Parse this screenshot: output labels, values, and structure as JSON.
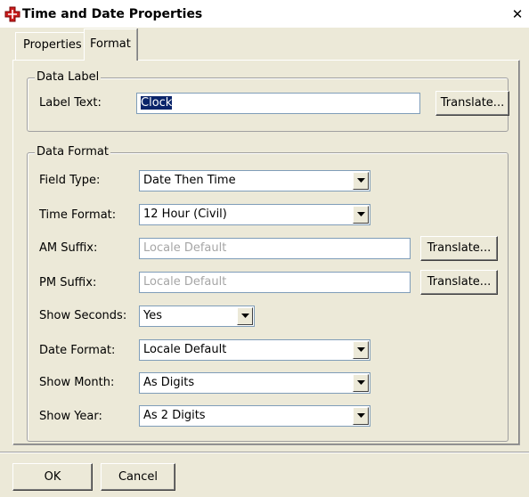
{
  "window": {
    "title": "Time and Date Properties",
    "close_glyph": "✕"
  },
  "tabs": [
    {
      "label": "Properties",
      "active": false
    },
    {
      "label": "Format",
      "active": true
    }
  ],
  "data_label": {
    "group_title": "Data Label",
    "label_text_label": "Label Text:",
    "label_text_value": "Clock",
    "translate_label": "Translate..."
  },
  "data_format": {
    "group_title": "Data Format",
    "field_type": {
      "label": "Field Type:",
      "value": "Date Then Time"
    },
    "time_format": {
      "label": "Time Format:",
      "value": "12 Hour (Civil)"
    },
    "am_suffix": {
      "label": "AM Suffix:",
      "placeholder": "Locale Default",
      "translate_label": "Translate..."
    },
    "pm_suffix": {
      "label": "PM Suffix:",
      "placeholder": "Locale Default",
      "translate_label": "Translate..."
    },
    "show_seconds": {
      "label": "Show Seconds:",
      "value": "Yes"
    },
    "date_format": {
      "label": "Date Format:",
      "value": "Locale Default"
    },
    "show_month": {
      "label": "Show Month:",
      "value": "As Digits"
    },
    "show_year": {
      "label": "Show Year:",
      "value": "As 2 Digits"
    }
  },
  "buttons": {
    "ok": "OK",
    "cancel": "Cancel"
  },
  "colors": {
    "app_icon": "#cc1f1f",
    "dialog_bg": "#ece9d8",
    "field_border": "#7f9db9",
    "selection": "#0a246a"
  },
  "icons": {
    "app": "red-cross-icon",
    "dropdown": "chevron-down-icon"
  }
}
